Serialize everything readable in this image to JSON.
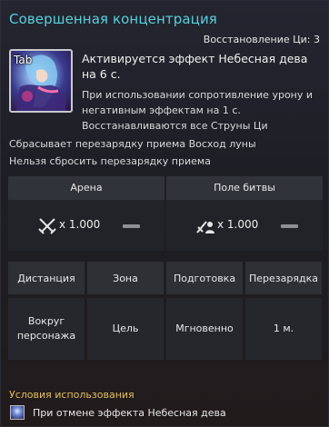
{
  "skill": {
    "title": "Совершенная концентрация",
    "recovery": "Восстановление Ци: 3",
    "hotkey": "Tab",
    "effect_main": "Активируется эффект Небесная дева на 6 с.",
    "effect_detail_1": "При использовании сопротивление урону и негативным эффектам на 1 с.",
    "effect_detail_2": "Восстанавливаются все Струны Ци",
    "reset_line_1": "Сбрасывает перезарядку приема Восход луны",
    "reset_line_2": "Нельзя сбросить перезарядку приема"
  },
  "modifiers": [
    {
      "label": "Арена",
      "value": "x 1.000",
      "icon": "crossed-swords-icon"
    },
    {
      "label": "Поле битвы",
      "value": "x 1.000",
      "icon": "sword-person-icon"
    }
  ],
  "properties": {
    "headers": [
      "Дистанция",
      "Зона",
      "Подготовка",
      "Перезарядка"
    ],
    "values": [
      "Вокруг персонажа",
      "Цель",
      "Мгновенно",
      "1 м."
    ]
  },
  "conditions": {
    "title": "Условия использования",
    "item": "При отмене эффекта Небесная дева"
  }
}
